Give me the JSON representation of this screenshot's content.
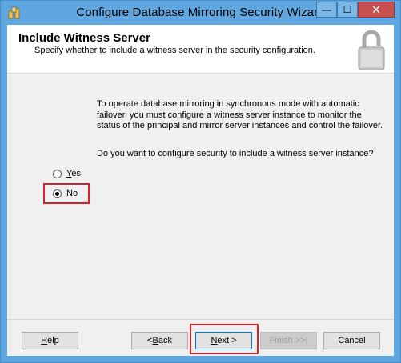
{
  "window": {
    "title": "Configure Database Mirroring Security Wizard",
    "controls": {
      "minimize": "—",
      "maximize": "☐",
      "close": "✕"
    }
  },
  "header": {
    "title": "Include Witness Server",
    "subtitle": "Specify whether to include a witness server in the security configuration.",
    "icon": "padlock-icon"
  },
  "content": {
    "description": "To operate database mirroring in synchronous mode with automatic failover, you must configure a witness server instance to monitor the status of the principal and mirror server instances and control the failover.",
    "question": "Do you want to configure security to include a witness server instance?",
    "options": [
      {
        "label": "Yes",
        "accel": "Y",
        "rest": "es",
        "checked": false
      },
      {
        "label": "No",
        "accel": "N",
        "rest": "o",
        "checked": true
      }
    ]
  },
  "buttons": {
    "help": {
      "accel": "H",
      "rest": "elp"
    },
    "back": {
      "prefix": "< ",
      "accel": "B",
      "rest": "ack"
    },
    "next": {
      "accel": "N",
      "rest": "ext >"
    },
    "finish": {
      "label": "Finish >>|"
    },
    "cancel": {
      "label": "Cancel"
    }
  },
  "colors": {
    "titlebar": "#5ea7e0",
    "highlight": "#d9212a",
    "close": "#c75050"
  }
}
